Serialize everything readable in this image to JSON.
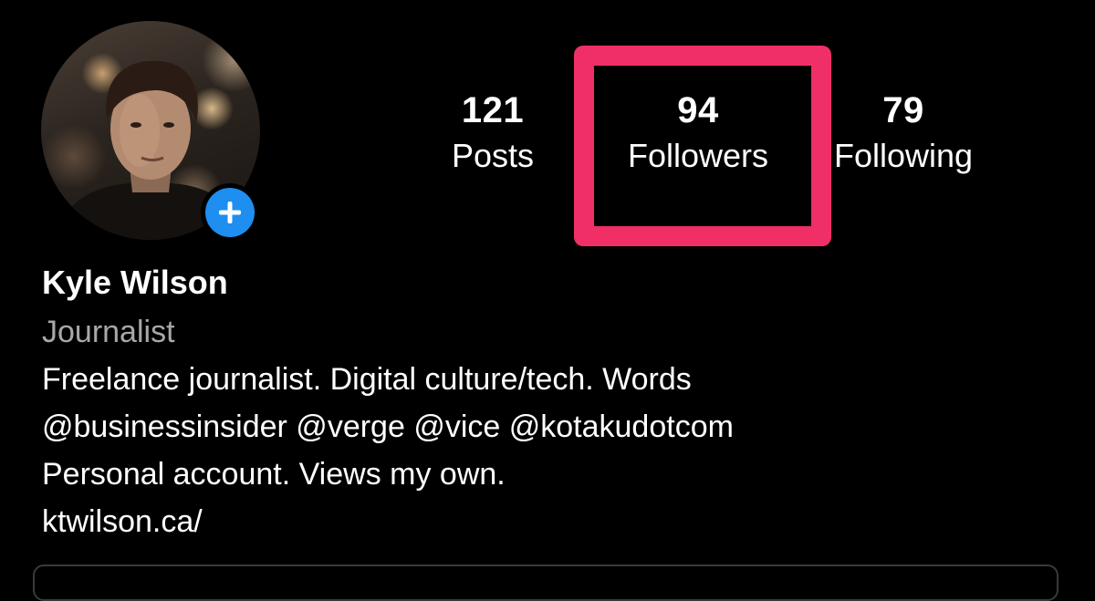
{
  "profile": {
    "avatar_icon": "profile-photo",
    "add_icon": "plus-icon",
    "add_color": "#1e8ef0",
    "name": "Kyle Wilson",
    "category": "Journalist",
    "bio_lines": [
      "Freelance journalist. Digital culture/tech. Words",
      "@businessinsider @verge @vice @kotakudotcom",
      "Personal account. Views my own."
    ],
    "link": "ktwilson.ca/"
  },
  "stats": {
    "posts": {
      "count": "121",
      "label": "Posts"
    },
    "followers": {
      "count": "94",
      "label": "Followers"
    },
    "following": {
      "count": "79",
      "label": "Following"
    }
  },
  "annotation": {
    "highlight_color": "#f02f67"
  }
}
